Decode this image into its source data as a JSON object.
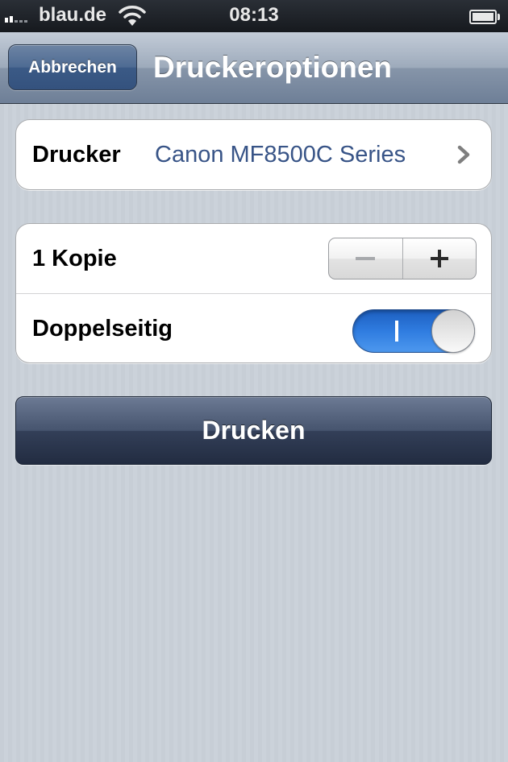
{
  "statusbar": {
    "carrier": "blau.de",
    "time": "08:13"
  },
  "navbar": {
    "back_label": "Abbrechen",
    "title": "Druckeroptionen"
  },
  "printer": {
    "label": "Drucker",
    "value": "Canon MF8500C Series"
  },
  "copies": {
    "label": "1 Kopie",
    "count": 1
  },
  "duplex": {
    "label": "Doppelseitig",
    "on": true
  },
  "print_button": {
    "label": "Drucken"
  },
  "colors": {
    "accent_value_text": "#385487",
    "toggle_on": "#2f7ce0",
    "print_button": "#333f58"
  },
  "icons": [
    "signal-icon",
    "wifi-icon",
    "battery-icon",
    "chevron-right-icon",
    "minus-icon",
    "plus-icon"
  ]
}
